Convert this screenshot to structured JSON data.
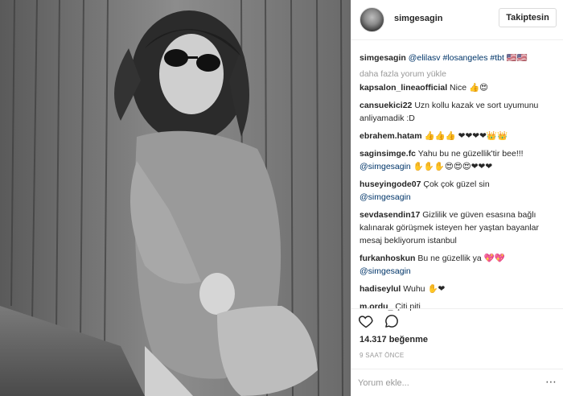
{
  "post": {
    "username": "simgesagin",
    "follow_label": "Takiptesin",
    "photo_alt": "photo"
  },
  "caption": {
    "username": "simgesagin",
    "text": "@elilasv #losangeles #tbt 🇺🇸🇺🇸"
  },
  "load_more": "daha fazla yorum yükle",
  "comments": [
    {
      "username": "kapsalon_lineaofficial",
      "text": "Nice 👍😍"
    },
    {
      "username": "cansuekici22",
      "text": "Uzn kollu kazak ve sort uyumunu anliyamadik :D"
    },
    {
      "username": "ebrahem.hatam",
      "text": "👍👍👍 ❤❤❤❤👑👑"
    },
    {
      "username": "saginsimge.fc",
      "text": "Yahu bu ne güzellik'tir bee!!!",
      "mention": "@simgesagin",
      "after": " ✋✋✋😍😍😍❤❤❤"
    },
    {
      "username": "huseyingode07",
      "text": "Çok çok güzel sin",
      "mention": "@simgesagin",
      "after": ""
    },
    {
      "username": "sevdasendin17",
      "text": "Gizlilik ve güven esasına bağlı kalınarak görüşmek isteyen her yaştan bayanlar mesaj bekliyorum istanbul"
    },
    {
      "username": "furkanhoskun",
      "text": "Bu ne güzellik ya 💖💖",
      "mention": "@simgesagin",
      "after": ""
    },
    {
      "username": "hadiseylul",
      "text": "Wuhu ✋❤"
    },
    {
      "username": "m.ordu_",
      "text": "Çiti piti"
    }
  ],
  "actions": {
    "like_icon": "heart-icon",
    "comment_icon": "comment-icon"
  },
  "likes": "14.317 beğenme",
  "time": "9 SAAT ÖNCE",
  "comment_input": {
    "placeholder": "Yorum ekle..."
  },
  "more_icon": "more-icon",
  "colors": {
    "mention": "#003569",
    "muted": "#999999",
    "border": "#efefef"
  }
}
